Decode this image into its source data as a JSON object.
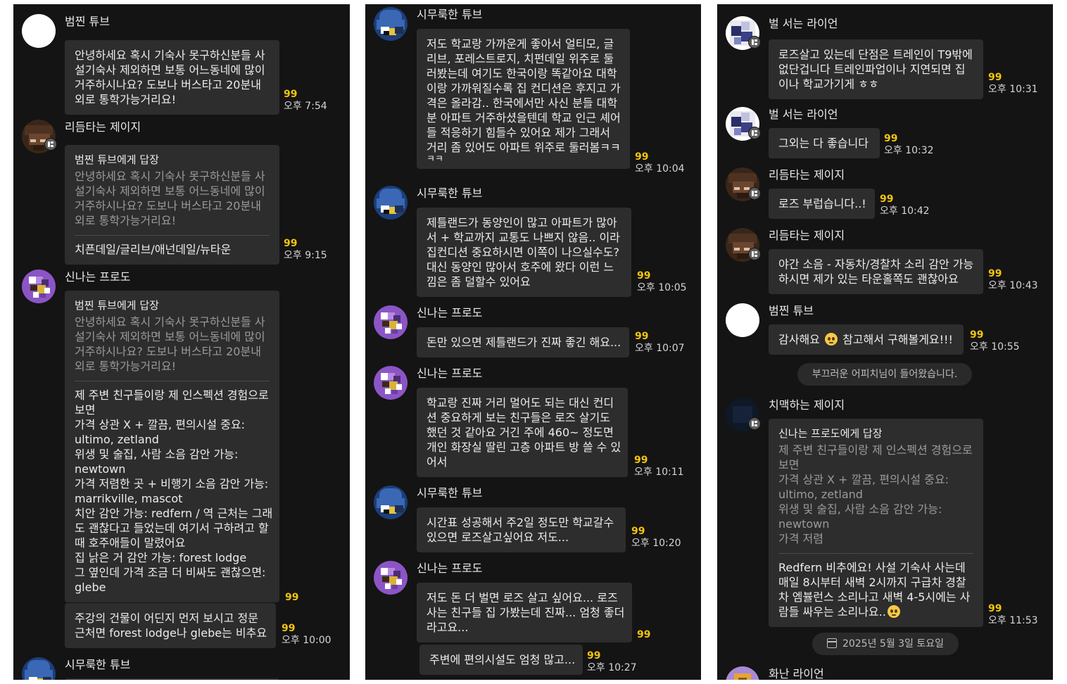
{
  "col1": {
    "m1": {
      "name": "범찐 튜브",
      "text": [
        "안녕하세요 혹시 기숙사 못구하신분들 사",
        "설기숙사 제외하면 보통 어느동네에 많이",
        "거주하시나요? 도보나 버스타고 20분내",
        "외로 통학가능거리요!"
      ],
      "unread": "99",
      "time": "오후 7:54"
    },
    "m2": {
      "name": "리듬타는 제이지",
      "reply_label": "범찐 튜브에게 답장",
      "quote": [
        "안녕하세요 혹시 기숙사 못구하신분들 사",
        "설기숙사 제외하면 보통 어느동네에 많이",
        "거주하시나요? 도보나 버스타고 20분내",
        "외로 통학가능거리요!"
      ],
      "text": [
        "치픈데일/글리브/애넌데일/뉴타운"
      ],
      "unread": "99",
      "time": "오후 9:15"
    },
    "m3": {
      "name": "신나는 프로도",
      "reply_label": "범찐 튜브에게 답장",
      "quote": [
        "안녕하세요 혹시 기숙사 못구하신분들 사",
        "설기숙사 제외하면 보통 어느동네에 많이",
        "거주하시나요? 도보나 버스타고 20분내",
        "외로 통학가능거리요!"
      ],
      "text": [
        "제 주변 친구들이랑 제 인스펙션 경험으로",
        "보면",
        "가격 상관 X + 깔끔, 편의시설 중요:",
        "ultimo, zetland",
        "위생 및 술집, 사람 소음 감안 가능:",
        "newtown",
        "가격 저렴한 곳 + 비행기 소음 감안 가능:",
        "marrikville, mascot",
        "치안 감안 가능: redfern / 역 근처는 그래",
        "도 괜찮다고 들었는데 여기서 구하려고 할",
        "때 호주애들이 말렸어요",
        "집 낡은 거 감안 가능: forest lodge",
        "그 옆인데 가격 조금 더 비싸도 괜찮으면:",
        "glebe"
      ],
      "unread": "99"
    },
    "m4": {
      "text": [
        "주강의 건물이 어딘지 먼저 보시고 정문",
        "근처면 forest lodge나 glebe는 비추요"
      ],
      "unread": "99",
      "time": "오후 10:00"
    },
    "m5": {
      "name": "시무룩한 튜브"
    }
  },
  "col2": {
    "m1": {
      "name": "시무룩한 튜브",
      "text": [
        "저도 학교랑 가까운게 좋아서 얼티모, 글",
        "리브, 포레스트로지, 치펀데일 위주로 둘",
        "러봤는데 여기도 한국이랑 똑같아요 대학",
        "이랑 가까워질수록 집 컨디션은 후지고 가",
        "격은 올라감.. 한국에서만 사신 분들 대학",
        "분 아파트 거주하셨을텐데 학교 인근 셰어",
        "들 적응하기 힘들수 있어요 제가 그래서",
        "거리 좀 있어도 아파트 위주로 둘러봄ㅋㅋ",
        "ㅋㅋ"
      ],
      "unread": "99",
      "time": "오후 10:04"
    },
    "m2": {
      "name": "시무룩한 튜브",
      "text": [
        "제틀랜드가 동양인이 많고 아파트가 많아",
        "서 + 학교까지 교통도 나쁘지 않음.. 이라",
        "집컨디션 중요하시면 이쪽이 나으실수도?",
        "대신 동양인 많아서 호주에 왔다 이런 느",
        "낌은 좀 덜할수 있어요"
      ],
      "unread": "99",
      "time": "오후 10:05"
    },
    "m3": {
      "name": "신나는 프로도",
      "text": [
        "돈만 있으면 제틀랜드가 진짜 좋긴 해요..."
      ],
      "unread": "99",
      "time": "오후 10:07"
    },
    "m4": {
      "name": "신나는 프로도",
      "text": [
        "학교랑 진짜 거리 멀어도 되는 대신 컨디",
        "션 중요하게 보는 친구들은 로즈 살기도",
        "했던 것 같아요 거긴 주에 460~ 정도면",
        "개인 화장실 딸린 고층 아파트 방 쓸 수 있",
        "어서"
      ],
      "unread": "99",
      "time": "오후 10:11"
    },
    "m5": {
      "name": "시무룩한 튜브",
      "text": [
        "시간표 성공해서 주2일 정도만 학교갈수",
        "있으면 로즈살고싶어요 저도..."
      ],
      "unread": "99",
      "time": "오후 10:20"
    },
    "m6": {
      "name": "신나는 프로도",
      "text": [
        "저도 돈 더 벌면 로즈 살고 싶어요... 로즈",
        "사는 친구들 집 가봤는데 진짜... 엄청 좋더",
        "라고요..."
      ],
      "unread": "99"
    },
    "m7": {
      "text": [
        "주변에 편의시설도 엄청 많고..."
      ],
      "unread": "99",
      "time": "오후 10:27"
    }
  },
  "col3": {
    "m1": {
      "name": "벌 서는 라이언",
      "text": [
        "로즈살고 있는데 단점은 트레인이 T9밖에",
        "없단겁니다 트레인파업이나 지연되면 집",
        "이나 학교가기게 ㅎㅎ"
      ],
      "unread": "99",
      "time": "오후 10:31"
    },
    "m2": {
      "name": "벌 서는 라이언",
      "text": [
        "그외는 다 좋습니다"
      ],
      "unread": "99",
      "time": "오후 10:32"
    },
    "m3": {
      "name": "리듬타는 제이지",
      "text": [
        "로즈 부럽습니다..!"
      ],
      "unread": "99",
      "time": "오후 10:42"
    },
    "m4": {
      "name": "리듬타는 제이지",
      "text": [
        "야간 소음 - 자동차/경찰차 소리 감안 가능",
        "하시면 제가 있는 타운홀쪽도 괜찮아요"
      ],
      "unread": "99",
      "time": "오후 10:43"
    },
    "m5": {
      "name": "범찐 튜브",
      "text_before": "감사해요",
      "text_after": "참고해서 구해볼게요!!!",
      "unread": "99",
      "time": "오후 10:55"
    },
    "system_join": "부끄러운 어피치님이 들어왔습니다.",
    "m6": {
      "name": "치맥하는 제이지",
      "reply_label": "신나는 프로도에게 답장",
      "quote": [
        "제 주변 친구들이랑 제 인스펙션 경험으로",
        "보면",
        "가격 상관 X + 깔끔, 편의시설 중요:",
        "ultimo, zetland",
        "위생 및 술집, 사람 소음 감안 가능:",
        "newtown",
        "가격 저렴"
      ],
      "text": [
        "Redfern 비추에요! 사설 기숙사 사는데",
        "매일 8시부터 새벽 2시까지 구급차 경찰",
        "차 엠뷸런스 소리나고 새벽 4-5시에는 사",
        "람들 싸우는 소리나요.."
      ],
      "unread": "99",
      "time": "오후 11:53"
    },
    "date_divider": "2025년 5월 3일 토요일",
    "m7": {
      "name": "화난 라이언"
    }
  },
  "colors": {
    "background": "#141414",
    "bubble": "#2d2d2d",
    "unread": "#f1c40f"
  }
}
